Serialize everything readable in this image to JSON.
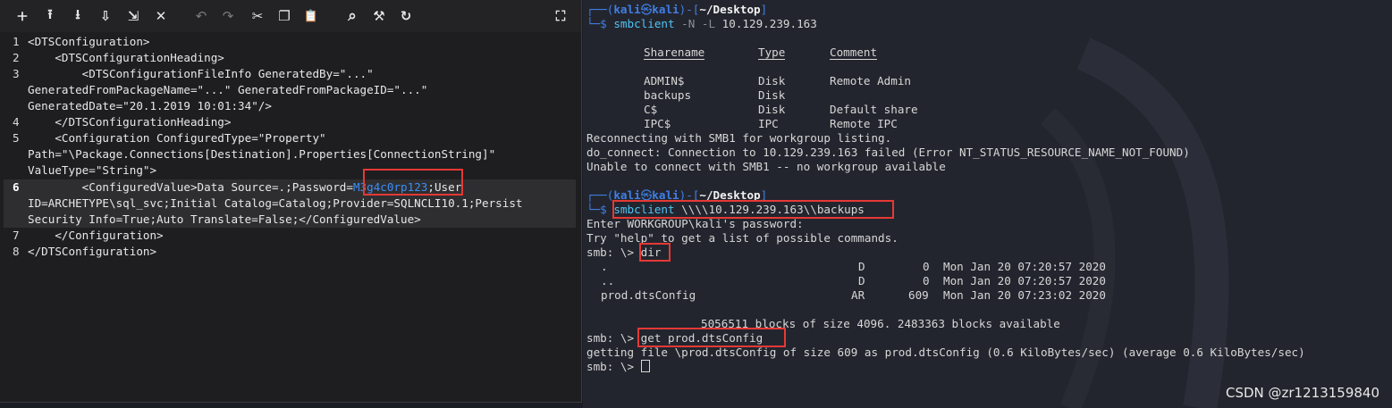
{
  "editor": {
    "toolbar": [
      {
        "name": "new-file-icon",
        "glyph": "🞣"
      },
      {
        "name": "upload-icon",
        "glyph": "⭱"
      },
      {
        "name": "download-icon",
        "glyph": "⭳"
      },
      {
        "name": "save-icon",
        "glyph": "⇩"
      },
      {
        "name": "open-icon",
        "glyph": "⇲"
      },
      {
        "name": "close-icon",
        "glyph": "✕"
      },
      {
        "name": "undo-icon",
        "glyph": "↶"
      },
      {
        "name": "redo-icon",
        "glyph": "↷"
      },
      {
        "name": "cut-icon",
        "glyph": "✂"
      },
      {
        "name": "copy-icon",
        "glyph": "❐"
      },
      {
        "name": "paste-icon",
        "glyph": "📋"
      },
      {
        "name": "search-icon",
        "glyph": "⌕"
      },
      {
        "name": "replace-icon",
        "glyph": "⚒"
      },
      {
        "name": "goto-icon",
        "glyph": "↻"
      },
      {
        "name": "fullscreen-icon",
        "glyph": "⛶"
      }
    ],
    "lines": [
      {
        "num": "1",
        "text": "<DTSConfiguration>"
      },
      {
        "num": "2",
        "text": "    <DTSConfigurationHeading>"
      },
      {
        "num": "3",
        "text": "        <DTSConfigurationFileInfo GeneratedBy=\"...\""
      },
      {
        "num": "",
        "text": "GeneratedFromPackageName=\"...\" GeneratedFromPackageID=\"...\""
      },
      {
        "num": "",
        "text": "GeneratedDate=\"20.1.2019 10:01:34\"/>"
      },
      {
        "num": "4",
        "text": "    </DTSConfigurationHeading>"
      },
      {
        "num": "5",
        "text": "    <Configuration ConfiguredType=\"Property\""
      },
      {
        "num": "",
        "text": "Path=\"\\Package.Connections[Destination].Properties[ConnectionString]\""
      },
      {
        "num": "",
        "text": "ValueType=\"String\">"
      },
      {
        "num": "6",
        "pre": "        <ConfiguredValue>Data Source=.;Password=",
        "password": "M3g4c0rp123",
        "post": ";User"
      },
      {
        "num": "",
        "text": "ID=ARCHETYPE\\sql_svc;Initial Catalog=Catalog;Provider=SQLNCLI10.1;Persist"
      },
      {
        "num": "",
        "text": "Security Info=True;Auto Translate=False;</ConfiguredValue>"
      },
      {
        "num": "7",
        "text": "    </Configuration>"
      },
      {
        "num": "8",
        "text": "</DTSConfiguration>"
      }
    ]
  },
  "terminal": {
    "prompt1": {
      "open": "┌──(",
      "user": "kali",
      "at": "㉿",
      "host": "kali",
      "mid": ")-[",
      "dir": "~/Desktop",
      "close": "]"
    },
    "cmd1": {
      "arrow": "└─$ ",
      "cmd": "smbclient",
      "args": " -N -L ",
      "target": "10.129.239.163"
    },
    "share_headers": [
      "Sharename",
      "Type",
      "Comment"
    ],
    "shares": [
      [
        "ADMIN$",
        "Disk",
        "Remote Admin"
      ],
      [
        "backups",
        "Disk",
        ""
      ],
      [
        "C$",
        "Disk",
        "Default share"
      ],
      [
        "IPC$",
        "IPC",
        "Remote IPC"
      ]
    ],
    "messages": [
      "Reconnecting with SMB1 for workgroup listing.",
      "do_connect: Connection to 10.129.239.163 failed (Error NT_STATUS_RESOURCE_NAME_NOT_FOUND)",
      "Unable to connect with SMB1 -- no workgroup available"
    ],
    "prompt2": {
      "open": "┌──(",
      "user": "kali",
      "at": "㉿",
      "host": "kali",
      "mid": ")-[",
      "dir": "~/Desktop",
      "close": "]"
    },
    "cmd2": {
      "arrow": "└─$ ",
      "cmd": "smbclient",
      "args": " \\\\\\\\10.129.239.163\\\\backups"
    },
    "password_prompt": "Enter WORKGROUP\\kali's password:",
    "help_hint": "Try \"help\" to get a list of possible commands.",
    "smb_prompt": "smb: \\> ",
    "dir_cmd": "dir",
    "dir_entries": [
      {
        "name": ".",
        "attr": "D",
        "size": "0",
        "date": "Mon Jan 20 07:20:57 2020"
      },
      {
        "name": "..",
        "attr": "D",
        "size": "0",
        "date": "Mon Jan 20 07:20:57 2020"
      },
      {
        "name": "prod.dtsConfig",
        "attr": "AR",
        "size": "609",
        "date": "Mon Jan 20 07:23:02 2020"
      }
    ],
    "blocks_info": "5056511 blocks of size 4096. 2483363 blocks available",
    "get_cmd": "get prod.dtsConfig",
    "get_result": "getting file \\prod.dtsConfig of size 609 as prod.dtsConfig (0.6 KiloBytes/sec) (average 0.6 KiloBytes/sec)"
  },
  "watermark": "CSDN @zr1213159840",
  "colors": {
    "prompt": "#3f7fe6",
    "command": "#4fc3f7",
    "highlight_box": "#e53935",
    "password": "#3d8ef5"
  }
}
